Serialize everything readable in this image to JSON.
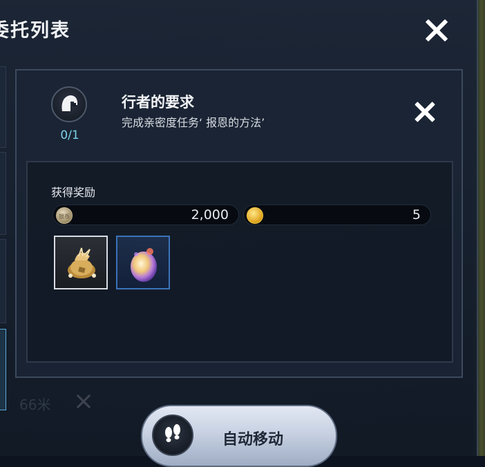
{
  "window": {
    "title": "委托列表",
    "close_icon": "close-icon"
  },
  "background": {
    "ghost_text": "66米"
  },
  "quest": {
    "icon": "helmet-icon",
    "progress": "0/1",
    "title": "行者的要求",
    "description": "完成亲密度任务‘ 报恩的方法’",
    "close_icon": "close-icon"
  },
  "rewards": {
    "label": "获得奖励",
    "currencies": [
      {
        "icon": "silver-coin-icon",
        "icon_text": "银币",
        "value": "2,000"
      },
      {
        "icon": "gold-coin-icon",
        "value": "5"
      }
    ],
    "items": [
      {
        "icon": "gold-pouch-icon",
        "rarity_color": "#d9dde3"
      },
      {
        "icon": "glowing-egg-icon",
        "rarity_color": "#3a73b8"
      }
    ]
  },
  "actions": {
    "auto_move_label": "自动移动",
    "auto_move_icon": "footprints-icon"
  },
  "colors": {
    "accent_cyan": "#7ad3e8",
    "button_face": "#d3dbe9"
  }
}
